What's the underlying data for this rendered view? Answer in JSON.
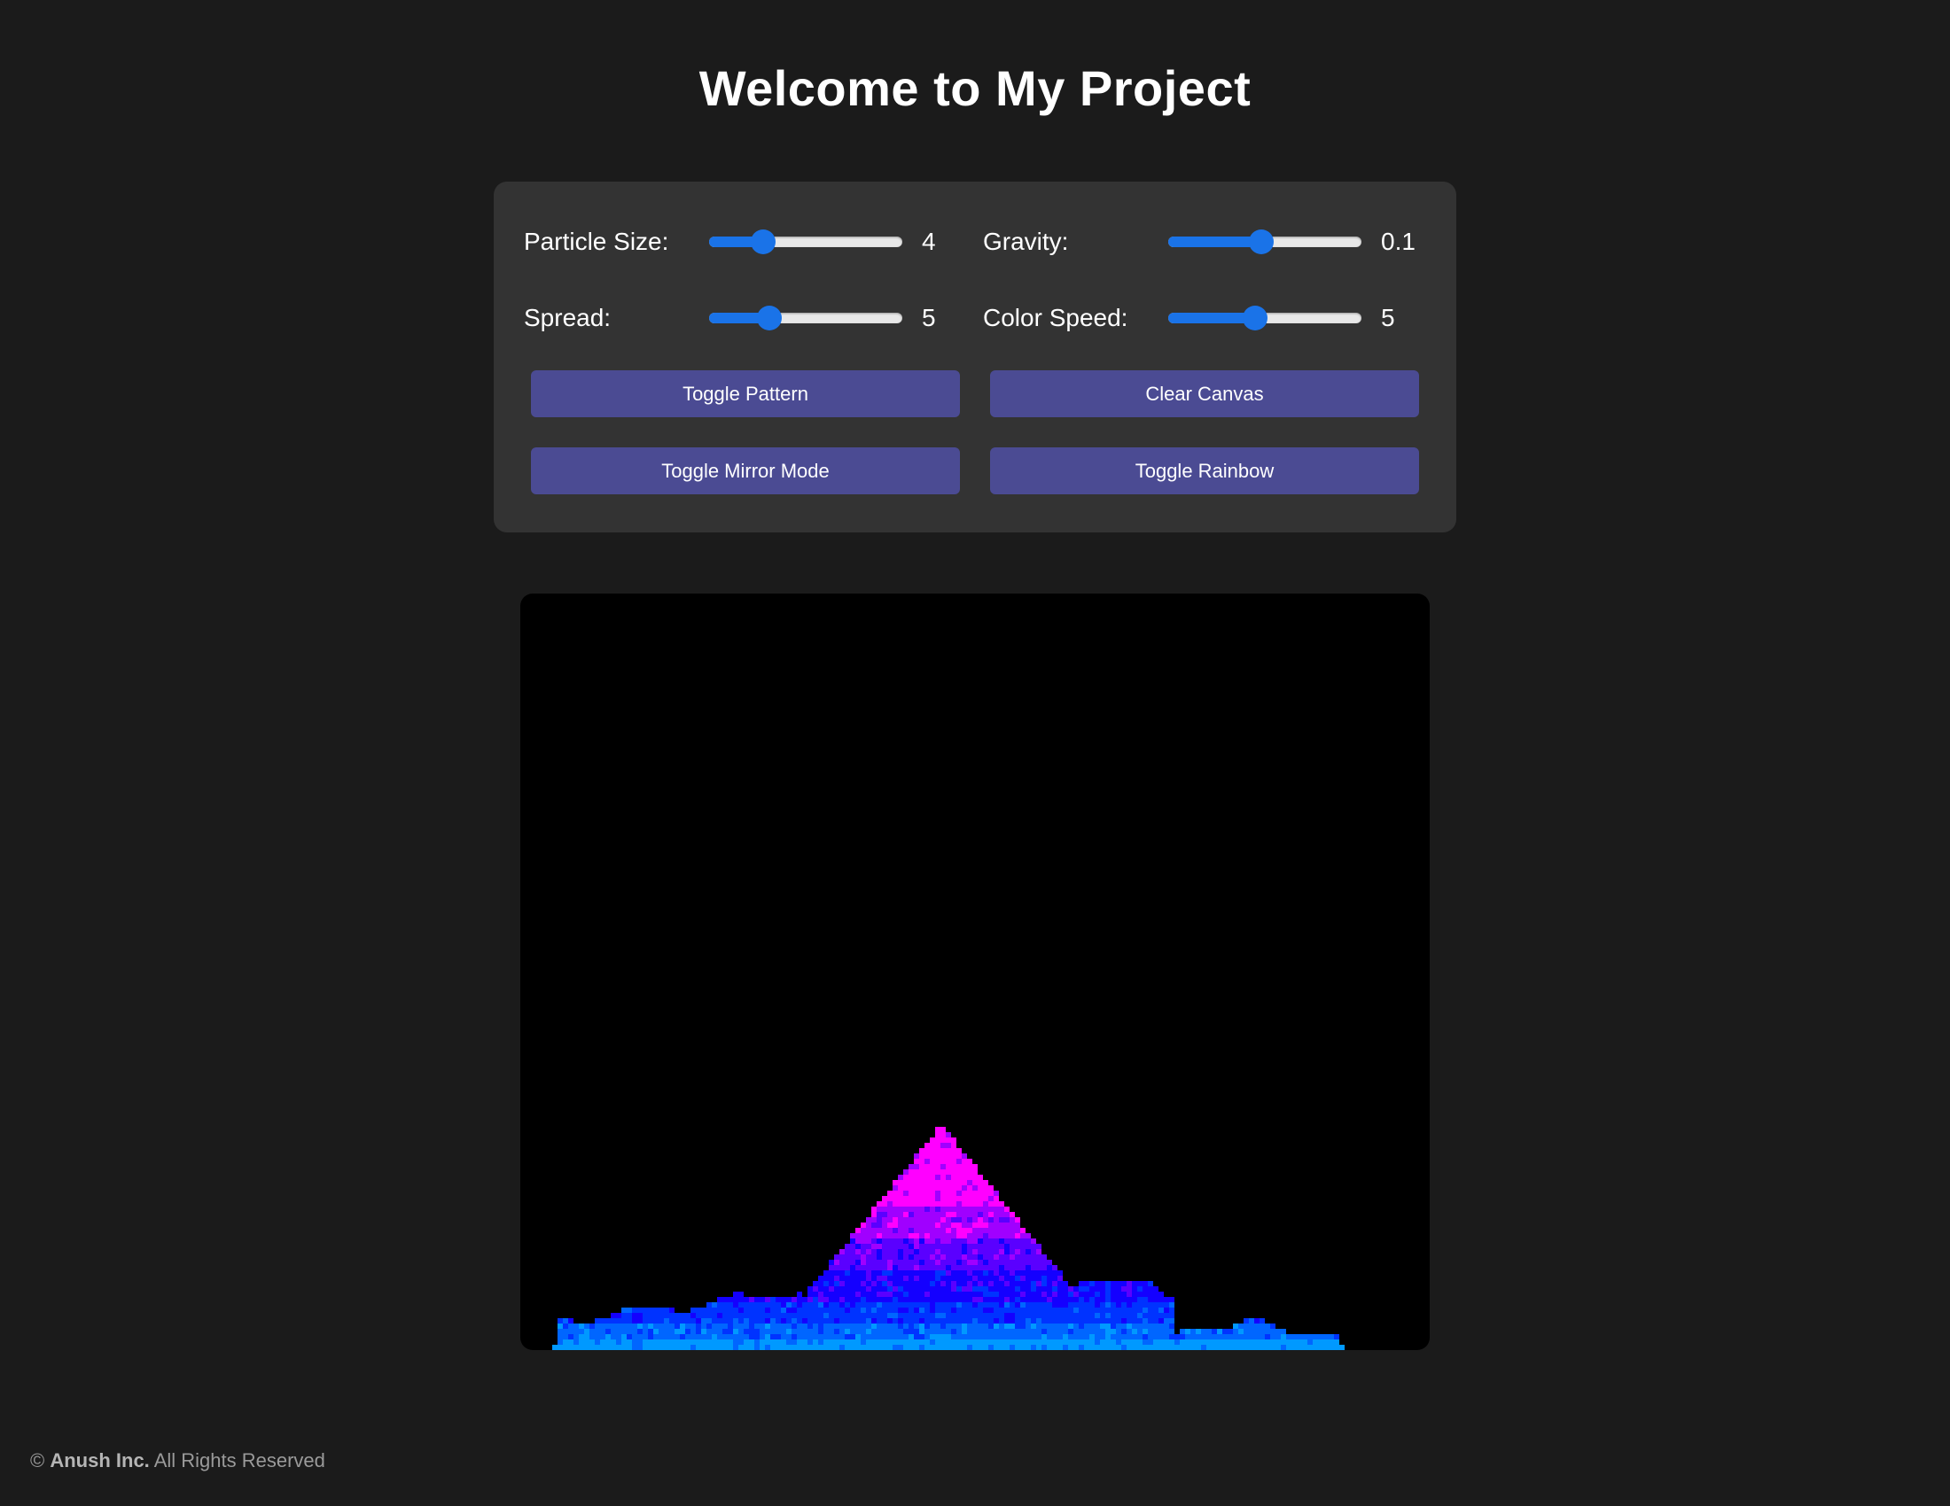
{
  "page": {
    "title": "Welcome to My Project"
  },
  "controls": {
    "particle_size": {
      "label": "Particle Size:",
      "value": "4",
      "fraction": 0.28
    },
    "gravity": {
      "label": "Gravity:",
      "value": "0.1",
      "fraction": 0.48
    },
    "spread": {
      "label": "Spread:",
      "value": "5",
      "fraction": 0.31
    },
    "color_speed": {
      "label": "Color Speed:",
      "value": "5",
      "fraction": 0.45
    },
    "slider_color": "#1a73e8"
  },
  "buttons": {
    "toggle_pattern": "Toggle Pattern",
    "clear_canvas": "Clear Canvas",
    "toggle_mirror_mode": "Toggle Mirror Mode",
    "toggle_rainbow": "Toggle Rainbow",
    "button_color": "#4b4b93"
  },
  "canvas": {
    "background": "#000000",
    "particle_colors": [
      "#ff00ff",
      "#a000ff",
      "#5a00ff",
      "#1400ff",
      "#0033ff",
      "#0066ff",
      "#0099ff"
    ]
  },
  "footer": {
    "copyright_symbol": "©",
    "company": "Anush Inc.",
    "rights": "All Rights Reserved"
  }
}
